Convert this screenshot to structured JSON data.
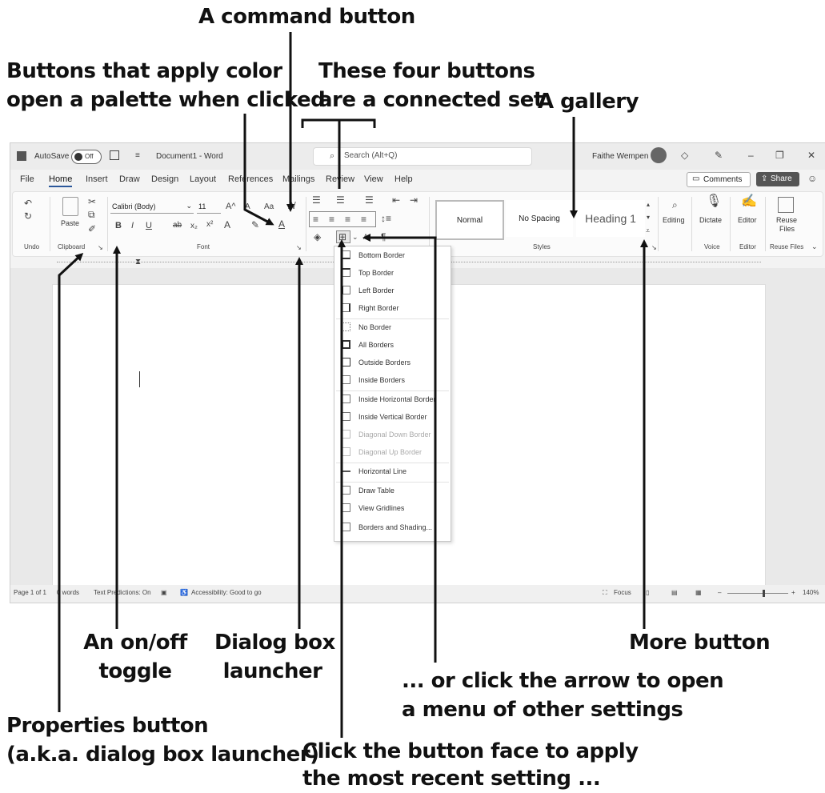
{
  "callouts": {
    "command_button": "A command button",
    "color_buttons_1": "Buttons that apply color",
    "color_buttons_2": "open a palette when clicked",
    "four_buttons_1": "These four buttons",
    "four_buttons_2": "are a connected set",
    "gallery": "A gallery",
    "toggle_1": "An on/off",
    "toggle_2": "toggle",
    "dialog_1": "Dialog box",
    "dialog_2": "launcher",
    "more": "More button",
    "arrow_1": "... or click the arrow to open",
    "arrow_2": "a menu of other settings",
    "properties_1": "Properties button",
    "properties_2": "(a.k.a. dialog box launcher)",
    "face_1": "Click the button face to apply",
    "face_2": "the most recent setting ..."
  },
  "titlebar": {
    "autosave": "AutoSave",
    "toggle_state": "Off",
    "doc_name": "Document1 - Word",
    "search_placeholder": "Search (Alt+Q)",
    "user": "Faithe Wempen"
  },
  "menu": {
    "items": [
      "File",
      "Home",
      "Insert",
      "Draw",
      "Design",
      "Layout",
      "References",
      "Mailings",
      "Review",
      "View",
      "Help"
    ],
    "comments": "Comments",
    "share": "Share"
  },
  "ribbon": {
    "paste": "Paste",
    "font_name": "Calibri (Body)",
    "font_size": "11",
    "style_normal": "Normal",
    "style_nospacing": "No Spacing",
    "style_heading1": "Heading 1",
    "editing": "Editing",
    "dictate": "Dictate",
    "editor": "Editor",
    "reuse_1": "Reuse",
    "reuse_2": "Files",
    "groups": {
      "undo": "Undo",
      "clipboard": "Clipboard",
      "font": "Font",
      "styles": "Styles",
      "voice": "Voice",
      "editor": "Editor",
      "reuse": "Reuse Files"
    }
  },
  "borders_menu": [
    {
      "label": "Bottom Border",
      "disabled": false
    },
    {
      "label": "Top Border",
      "disabled": false
    },
    {
      "label": "Left Border",
      "disabled": false
    },
    {
      "label": "Right Border",
      "disabled": false
    },
    {
      "label": "No Border",
      "disabled": false
    },
    {
      "label": "All Borders",
      "disabled": false
    },
    {
      "label": "Outside Borders",
      "disabled": false
    },
    {
      "label": "Inside Borders",
      "disabled": false
    },
    {
      "label": "Inside Horizontal Border",
      "disabled": false
    },
    {
      "label": "Inside Vertical Border",
      "disabled": false
    },
    {
      "label": "Diagonal Down Border",
      "disabled": true
    },
    {
      "label": "Diagonal Up Border",
      "disabled": true
    },
    {
      "label": "Horizontal Line",
      "disabled": false
    },
    {
      "label": "Draw Table",
      "disabled": false
    },
    {
      "label": "View Gridlines",
      "disabled": false
    },
    {
      "label": "Borders and Shading...",
      "disabled": false
    }
  ],
  "statusbar": {
    "page": "Page 1 of 1",
    "words": "0 words",
    "predictions": "Text Predictions: On",
    "accessibility": "Accessibility: Good to go",
    "focus": "Focus",
    "zoom": "140%"
  }
}
